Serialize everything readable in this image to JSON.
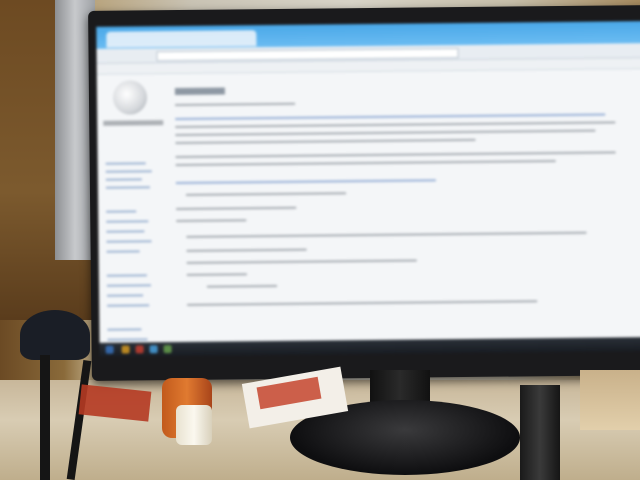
{
  "scene": {
    "description_colors": {
      "screen_bg": "#f4f6f8",
      "browser_chrome": "#4aa8e8",
      "link_blue": "#3d6cb6",
      "taskbar": "#1c2128"
    },
    "icons": [
      "wikipedia-globe-icon",
      "browser-tab-icon",
      "taskbar-icons"
    ]
  }
}
